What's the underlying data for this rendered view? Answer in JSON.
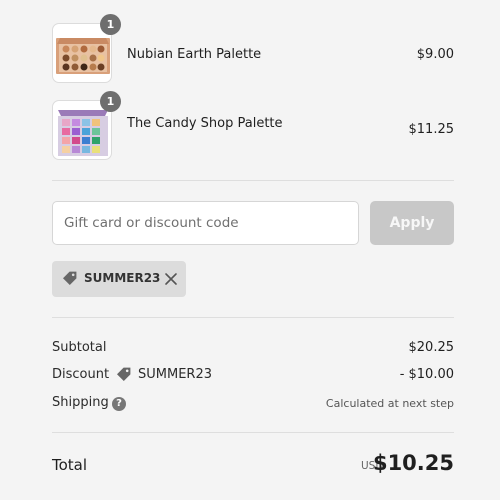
{
  "items": [
    {
      "name": "Nubian Earth Palette",
      "price": "$9.00",
      "quantity": "1",
      "thumbnail": "eyeshadow-palette-earth-tones"
    },
    {
      "name": "The Candy Shop Palette",
      "price": "$11.25",
      "quantity": "1",
      "thumbnail": "eyeshadow-palette-bright-colors"
    }
  ],
  "discount_form": {
    "placeholder": "Gift card or discount code",
    "value": "",
    "apply_label": "Apply"
  },
  "applied_code": {
    "code": "SUMMER23",
    "icon": "tag-icon",
    "remove_icon": "close-icon"
  },
  "summary": {
    "subtotal_label": "Subtotal",
    "subtotal_value": "$20.25",
    "discount_label": "Discount",
    "discount_code": "SUMMER23",
    "discount_value": "- $10.00",
    "shipping_label": "Shipping",
    "shipping_help_icon": "question-icon",
    "shipping_value": "Calculated at next step"
  },
  "total": {
    "label": "Total",
    "currency": "USD",
    "amount": "$10.25"
  },
  "colors": {
    "background": "#f4f4f4",
    "apply_button_disabled": "#c8c8c8",
    "chip_background": "#dcdcdc",
    "quantity_badge": "#6e6e6e"
  }
}
